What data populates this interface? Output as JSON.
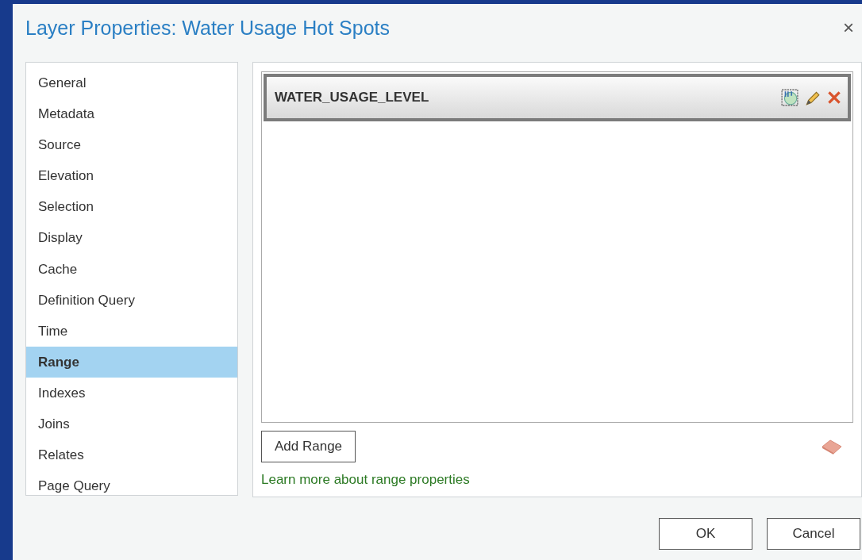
{
  "window": {
    "title": "Layer Properties: Water Usage Hot Spots",
    "close": "×"
  },
  "sidebar": {
    "items": [
      {
        "label": "General",
        "selected": false
      },
      {
        "label": "Metadata",
        "selected": false
      },
      {
        "label": "Source",
        "selected": false
      },
      {
        "label": "Elevation",
        "selected": false
      },
      {
        "label": "Selection",
        "selected": false
      },
      {
        "label": "Display",
        "selected": false
      },
      {
        "label": "Cache",
        "selected": false
      },
      {
        "label": "Definition Query",
        "selected": false
      },
      {
        "label": "Time",
        "selected": false
      },
      {
        "label": "Range",
        "selected": true
      },
      {
        "label": "Indexes",
        "selected": false
      },
      {
        "label": "Joins",
        "selected": false
      },
      {
        "label": "Relates",
        "selected": false
      },
      {
        "label": "Page Query",
        "selected": false
      }
    ]
  },
  "range": {
    "field": "WATER_USAGE_LEVEL",
    "add_button": "Add Range",
    "link": "Learn more about range properties"
  },
  "buttons": [
    "OK",
    "Cancel"
  ]
}
